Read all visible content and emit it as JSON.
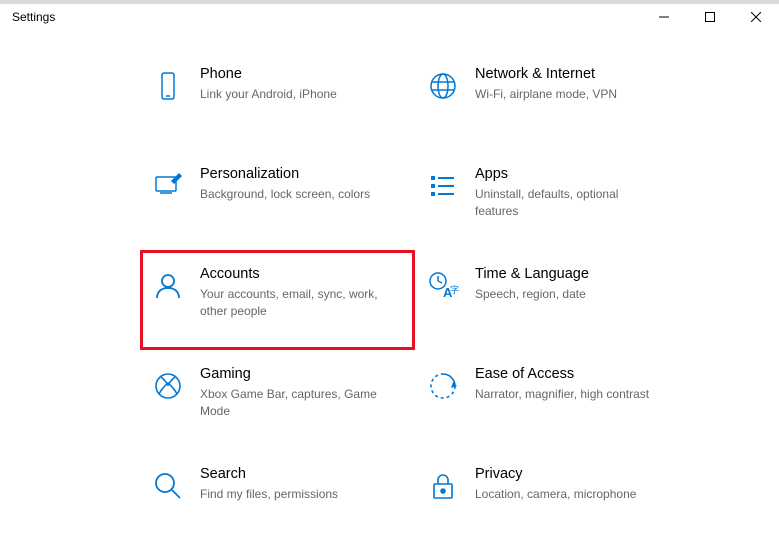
{
  "window": {
    "title": "Settings"
  },
  "tiles": [
    {
      "title": "Phone",
      "desc": "Link your Android, iPhone"
    },
    {
      "title": "Network & Internet",
      "desc": "Wi-Fi, airplane mode, VPN"
    },
    {
      "title": "Personalization",
      "desc": "Background, lock screen, colors"
    },
    {
      "title": "Apps",
      "desc": "Uninstall, defaults, optional features"
    },
    {
      "title": "Accounts",
      "desc": "Your accounts, email, sync, work, other people",
      "highlighted": true
    },
    {
      "title": "Time & Language",
      "desc": "Speech, region, date"
    },
    {
      "title": "Gaming",
      "desc": "Xbox Game Bar, captures, Game Mode"
    },
    {
      "title": "Ease of Access",
      "desc": "Narrator, magnifier, high contrast"
    },
    {
      "title": "Search",
      "desc": "Find my files, permissions"
    },
    {
      "title": "Privacy",
      "desc": "Location, camera, microphone"
    }
  ]
}
